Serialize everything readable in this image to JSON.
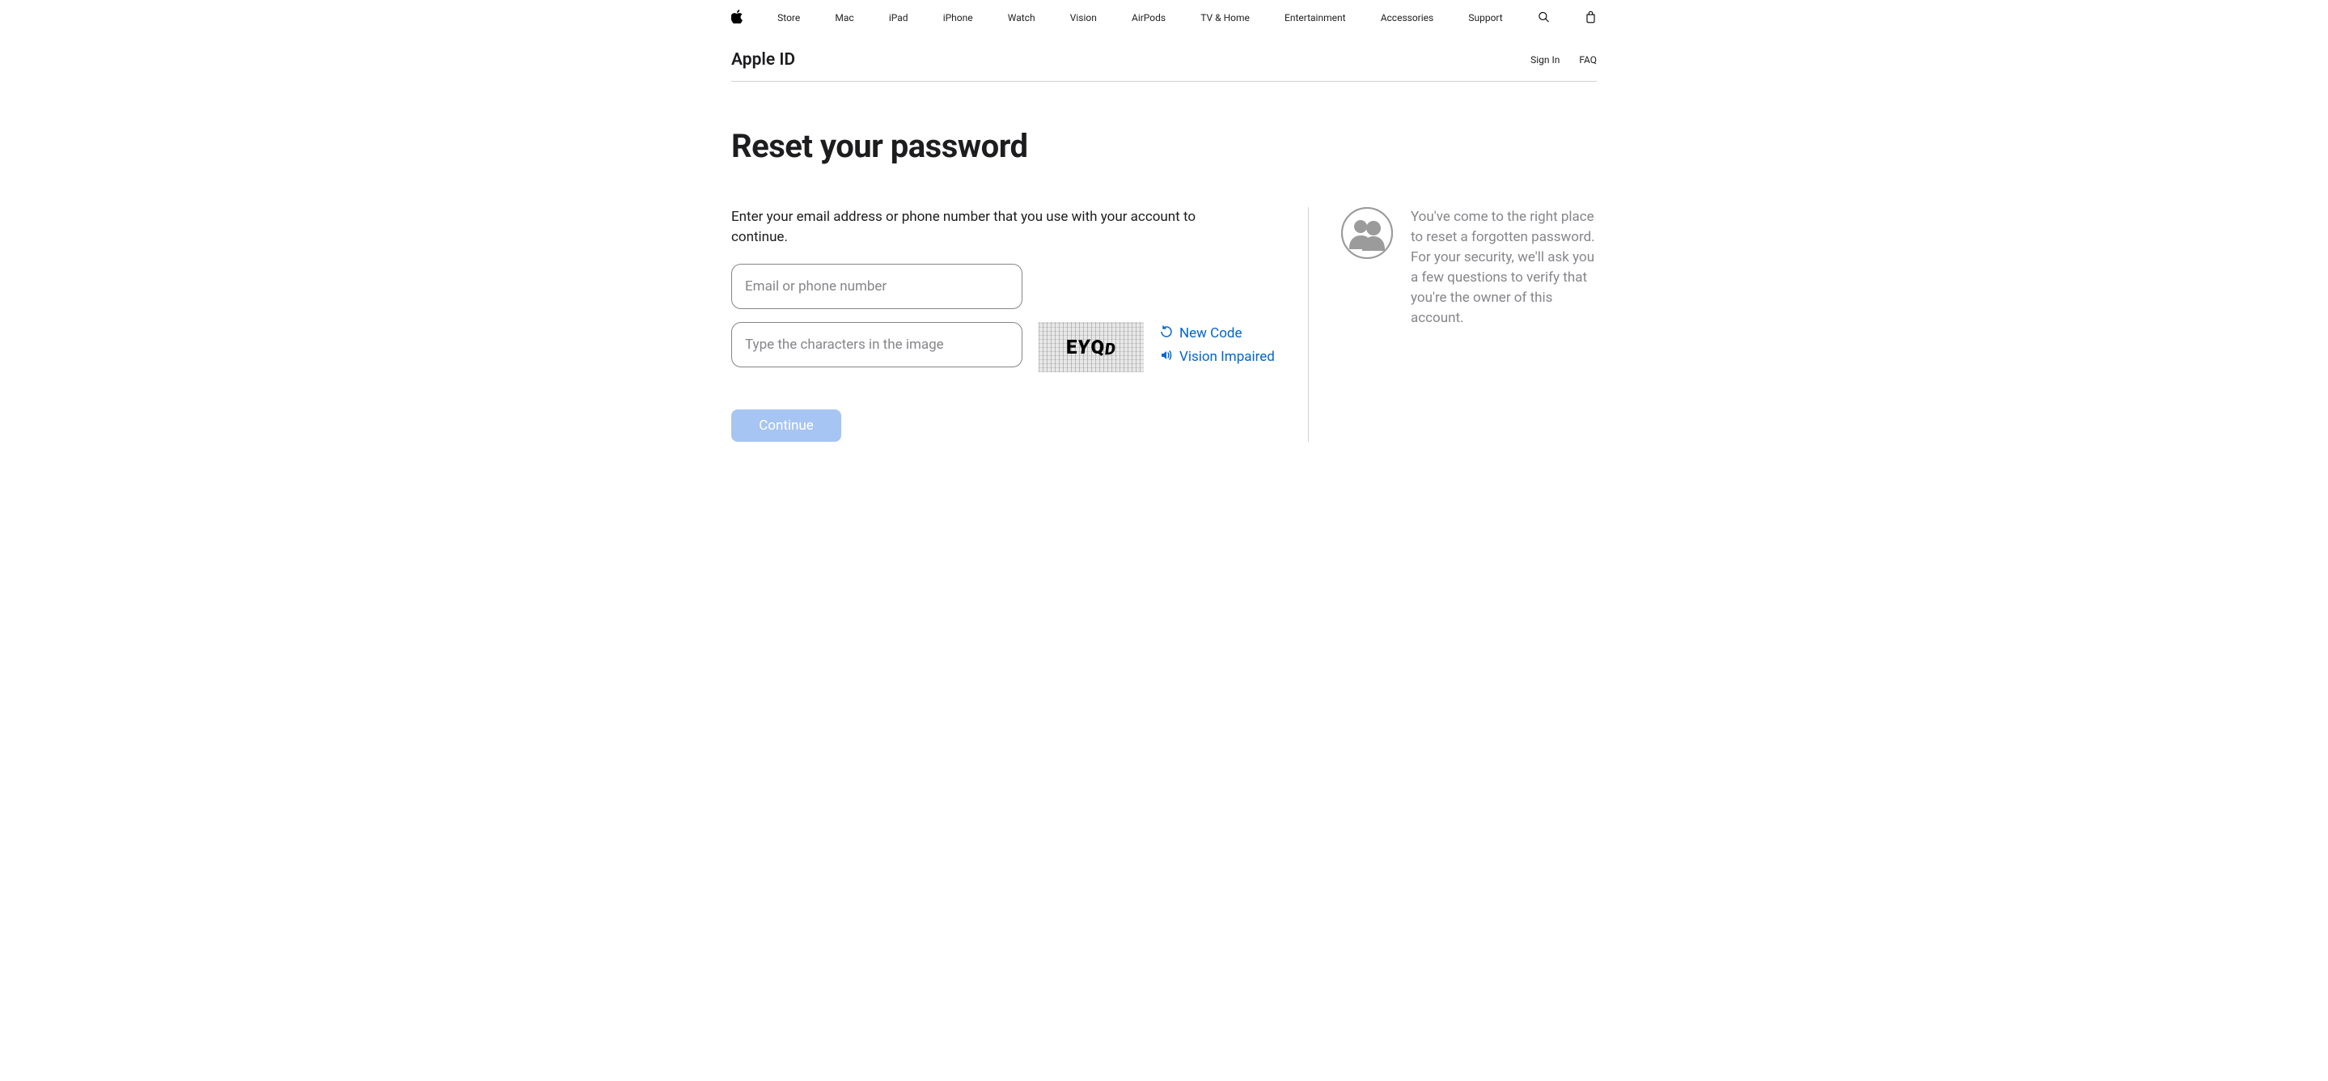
{
  "globalNav": {
    "items": [
      "Store",
      "Mac",
      "iPad",
      "iPhone",
      "Watch",
      "Vision",
      "AirPods",
      "TV & Home",
      "Entertainment",
      "Accessories",
      "Support"
    ]
  },
  "subNav": {
    "title": "Apple ID",
    "links": [
      "Sign In",
      "FAQ"
    ]
  },
  "page": {
    "title": "Reset your password",
    "instruction": "Enter your email address or phone number that you use with your account to continue.",
    "emailPlaceholder": "Email or phone number",
    "captchaPlaceholder": "Type the characters in the image",
    "captchaText": "EYQD",
    "newCode": "New Code",
    "visionImpaired": "Vision Impaired",
    "continueLabel": "Continue",
    "infoText": "You've come to the right place to reset a forgotten password. For your security, we'll ask you a few questions to verify that you're the owner of this account."
  }
}
